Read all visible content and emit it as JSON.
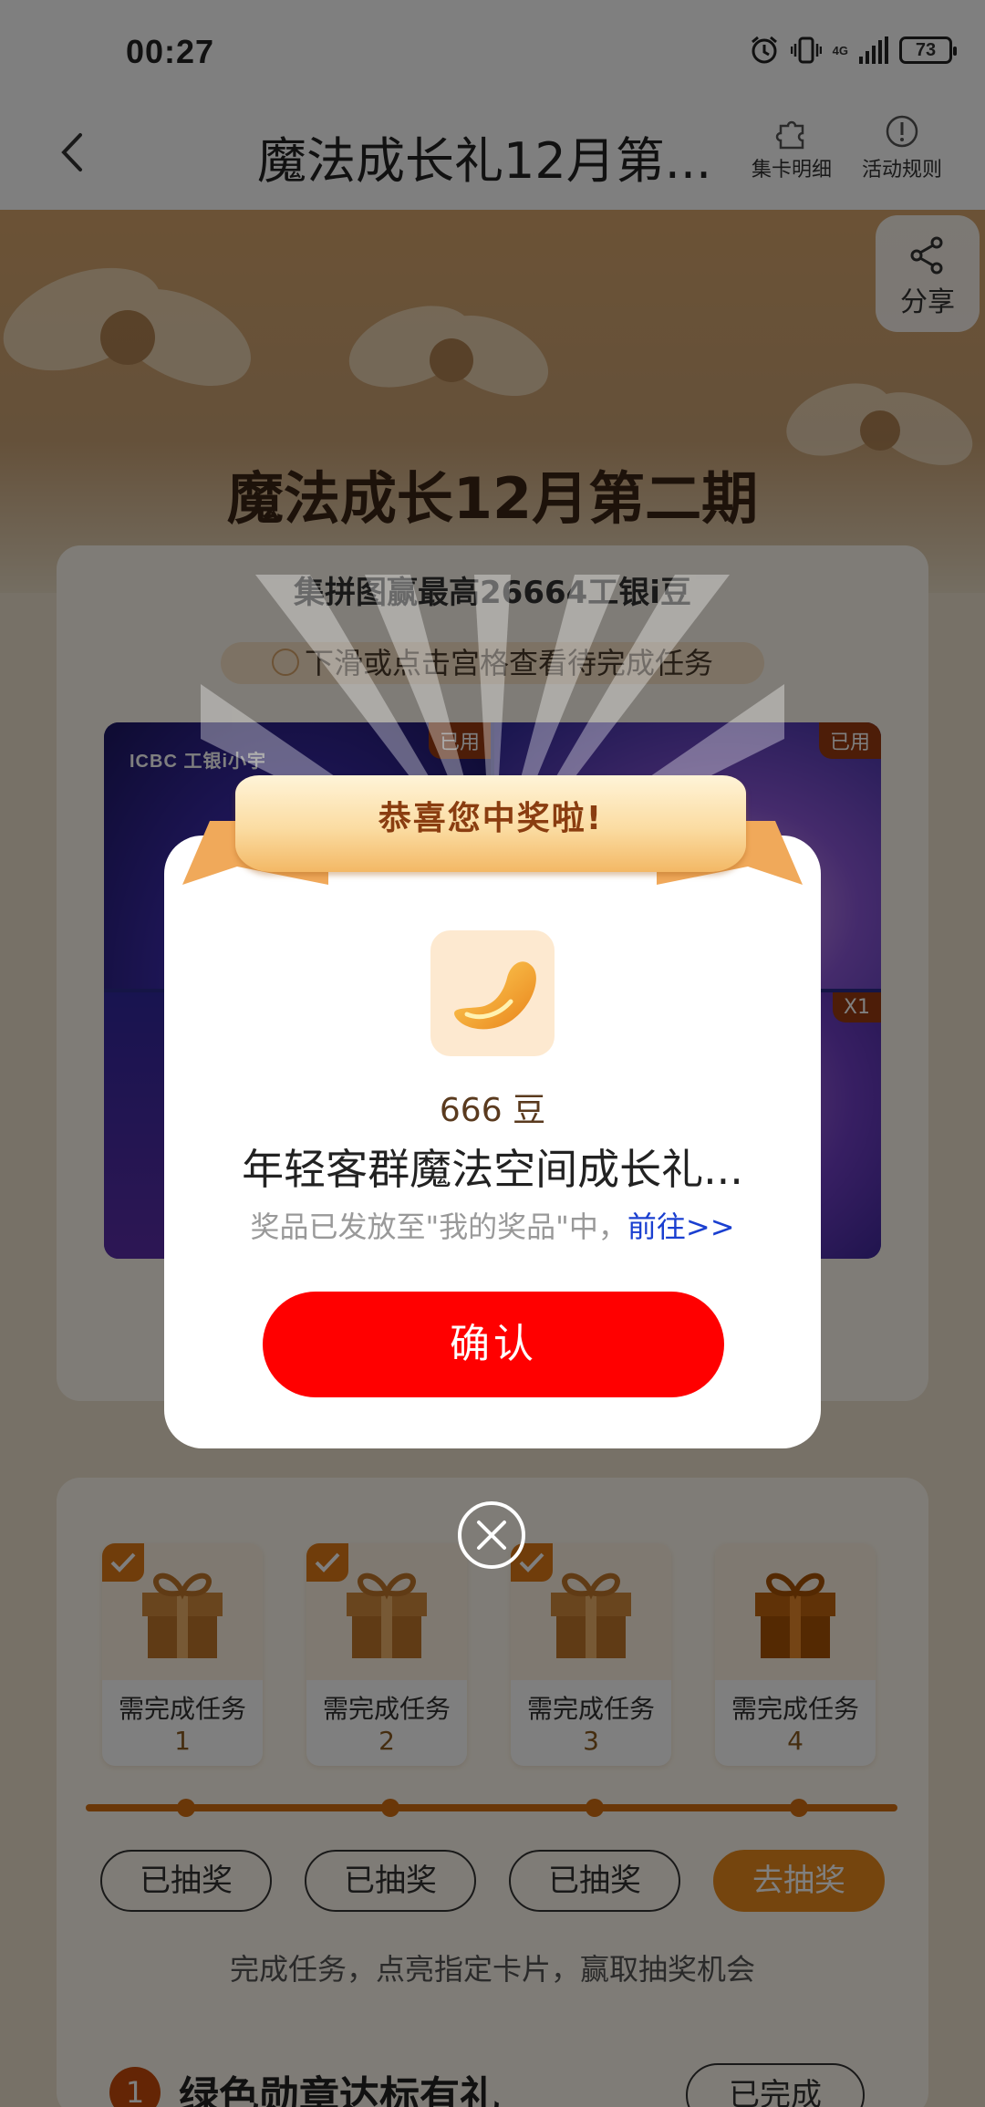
{
  "status_bar": {
    "time": "00:27",
    "network": "4G",
    "battery": "73"
  },
  "header": {
    "title": "魔法成长礼12月第...",
    "card_detail": "集卡明细",
    "rules": "活动规则"
  },
  "share": {
    "label": "分享"
  },
  "hero": {
    "title": "魔法成长12月第二期"
  },
  "main_card": {
    "subtitle": "集拼图赢最高26664工银i豆",
    "hint": "下滑或点击宫格查看待完成任务",
    "tiles": [
      {
        "badge": "已用"
      },
      {
        "badge": "已用"
      },
      {
        "badge": ""
      },
      {
        "badge": "X1"
      }
    ],
    "logo_text": "ICBC 工银i小宇"
  },
  "lottery": {
    "tasks": [
      {
        "label": "需完成任务",
        "num": "1",
        "checked": true
      },
      {
        "label": "需完成任务",
        "num": "2",
        "checked": true
      },
      {
        "label": "需完成任务",
        "num": "3",
        "checked": true
      },
      {
        "label": "需完成任务",
        "num": "4",
        "checked": false
      }
    ],
    "buttons": [
      "已抽奖",
      "已抽奖",
      "已抽奖",
      "去抽奖"
    ],
    "hint": "完成任务，点亮指定卡片，赢取抽奖机会"
  },
  "mission": {
    "num": "1",
    "name": "绿色勋章达标有礼",
    "status": "已完成"
  },
  "dialog": {
    "banner": "恭喜您中奖啦!",
    "amount": "666 豆",
    "prize_name": "年轻客群魔法空间成长礼...",
    "note": "奖品已发放至\"我的奖品\"中，",
    "link": "前往>>",
    "confirm": "确认"
  },
  "colors": {
    "confirm": "#ff0000",
    "accent": "#ea8a1c",
    "banner_text": "#8a3d10",
    "link": "#1a3fd0"
  }
}
